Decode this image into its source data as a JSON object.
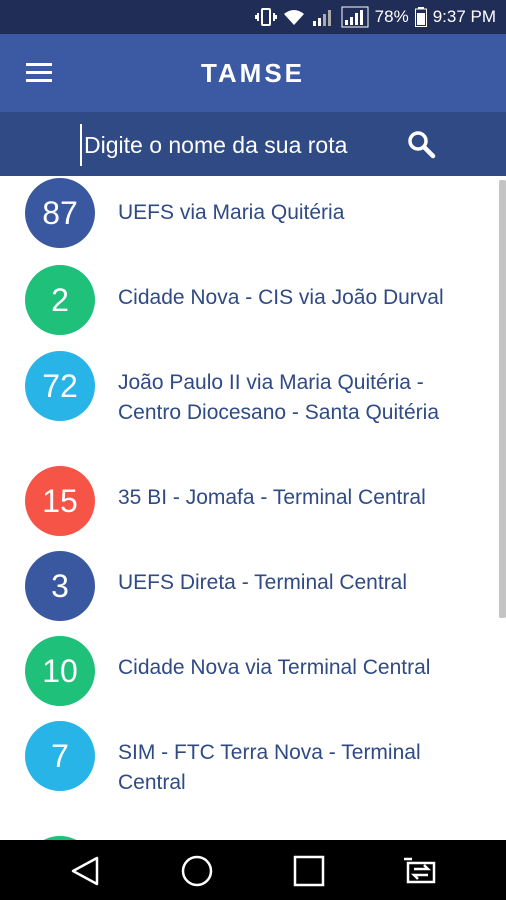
{
  "status_bar": {
    "battery": "78%",
    "time": "9:37 PM",
    "net_left": "2G",
    "net_right": "3G"
  },
  "app_bar": {
    "title": "TAMSE"
  },
  "search": {
    "placeholder": "Digite o nome da sua rota"
  },
  "colors": {
    "app_bar": "#3b5aa3",
    "search_bar": "#2f4a85",
    "status_bar": "#1f2d57",
    "route_text": "#2f4a85"
  },
  "routes": [
    {
      "number": "87",
      "name": "UEFS via Maria Quitéria",
      "color": "#3a58a0"
    },
    {
      "number": "2",
      "name": "Cidade Nova - CIS via João Durval",
      "color": "#1fc07a"
    },
    {
      "number": "72",
      "name": "João Paulo II via Maria Quitéria - Centro Diocesano - Santa Quitéria",
      "color": "#28b4e6"
    },
    {
      "number": "15",
      "name": "35 BI - Jomafa - Terminal Central",
      "color": "#f55447"
    },
    {
      "number": "3",
      "name": "UEFS Direta - Terminal Central",
      "color": "#3a58a0"
    },
    {
      "number": "10",
      "name": "Cidade Nova via Terminal Central",
      "color": "#1fc07a"
    },
    {
      "number": "7",
      "name": "SIM - FTC Terra Nova - Terminal Central",
      "color": "#28b4e6"
    },
    {
      "number": "",
      "name": "",
      "color": "#1fc07a"
    }
  ],
  "icons": {
    "menu": "hamburger-icon",
    "search": "search-icon",
    "back": "back-triangle-icon",
    "home": "home-circle-icon",
    "recents": "recents-square-icon",
    "switch": "switch-app-icon"
  }
}
